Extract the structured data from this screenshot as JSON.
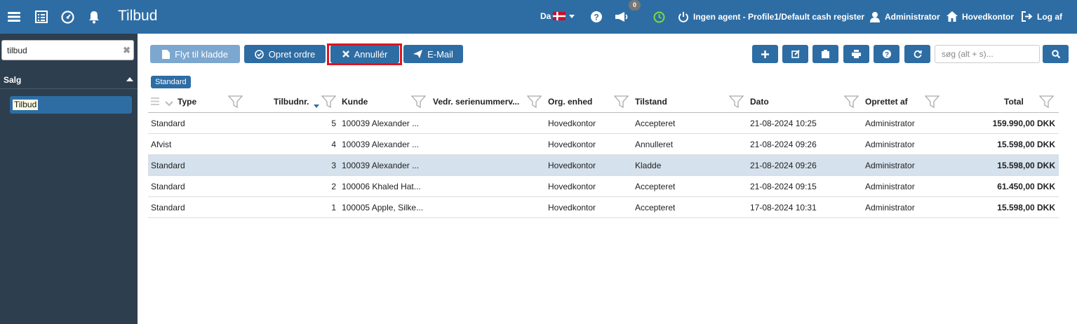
{
  "topbar": {
    "title": "Tilbud",
    "language": "Da",
    "notification_count": "0",
    "agent_status": "Ingen agent - Profile1/Default cash register",
    "user": "Administrator",
    "store": "Hovedkontor",
    "logout": "Log af",
    "bg_color": "#2e6da4"
  },
  "sidebar": {
    "search_value": "tilbud",
    "group_label": "Salg",
    "items": [
      {
        "label": "Tilbud"
      }
    ]
  },
  "toolbar": {
    "draft_label": "Flyt til kladde",
    "order_label": "Opret ordre",
    "cancel_label": "Annullér",
    "email_label": "E-Mail",
    "search_placeholder": "søg (alt + s)..."
  },
  "filter_tag": "Standard",
  "table": {
    "columns": [
      "Type",
      "Tilbudnr.",
      "Kunde",
      "Vedr. serienummerv...",
      "Org. enhed",
      "Tilstand",
      "Dato",
      "Oprettet af",
      "Total"
    ],
    "rows": [
      [
        "Standard",
        "5",
        "100039 Alexander ...",
        "",
        "Hovedkontor",
        "Accepteret",
        "21-08-2024 10:25",
        "Administrator",
        "159.990,00 DKK"
      ],
      [
        "Afvist",
        "4",
        "100039 Alexander ...",
        "",
        "Hovedkontor",
        "Annulleret",
        "21-08-2024 09:26",
        "Administrator",
        "15.598,00 DKK"
      ],
      [
        "Standard",
        "3",
        "100039 Alexander ...",
        "",
        "Hovedkontor",
        "Kladde",
        "21-08-2024 09:26",
        "Administrator",
        "15.598,00 DKK"
      ],
      [
        "Standard",
        "2",
        "100006 Khaled Hat...",
        "",
        "Hovedkontor",
        "Accepteret",
        "21-08-2024 09:15",
        "Administrator",
        "61.450,00 DKK"
      ],
      [
        "Standard",
        "1",
        "100005 Apple, Silke...",
        "",
        "Hovedkontor",
        "Accepteret",
        "17-08-2024 10:31",
        "Administrator",
        "15.598,00 DKK"
      ]
    ],
    "selected_row": 2
  }
}
